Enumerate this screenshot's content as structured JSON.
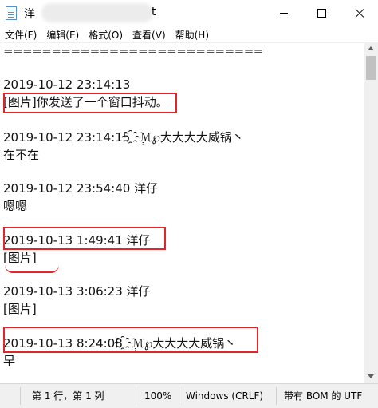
{
  "window": {
    "title_prefix": "洋",
    "title_suffix": "t",
    "minimize_label": "minimize",
    "maximize_label": "maximize",
    "close_label": "close"
  },
  "menu": [
    "文件(F)",
    "编辑(E)",
    "格式(O)",
    "查看(V)",
    "帮助(H)"
  ],
  "editor": {
    "separator": "===========================",
    "lines": [
      "2019-10-12 23:14:13",
      "[图片]你发送了一个窗口抖动。",
      "2019-10-12 23:14:15 ҈݄ℳ℘大大大大威锅丶",
      "在不在",
      "2019-10-12 23:54:40 洋仔",
      "嗯嗯",
      "2019-10-13 1:49:41 洋仔",
      "[图片]",
      "2019-10-13 3:06:23 洋仔",
      "[图片]",
      "2019-10-13 8:24:08 ҈݄ℳ℘大大大大威锅丶",
      "早"
    ]
  },
  "status": {
    "position": "第 1 行，第 1 列",
    "zoom": "100%",
    "line_ending": "Windows (CRLF)",
    "encoding": "带有 BOM 的 UTF"
  },
  "colors": {
    "highlight": "#e0262b",
    "statusbar": "#f0f0f0"
  }
}
